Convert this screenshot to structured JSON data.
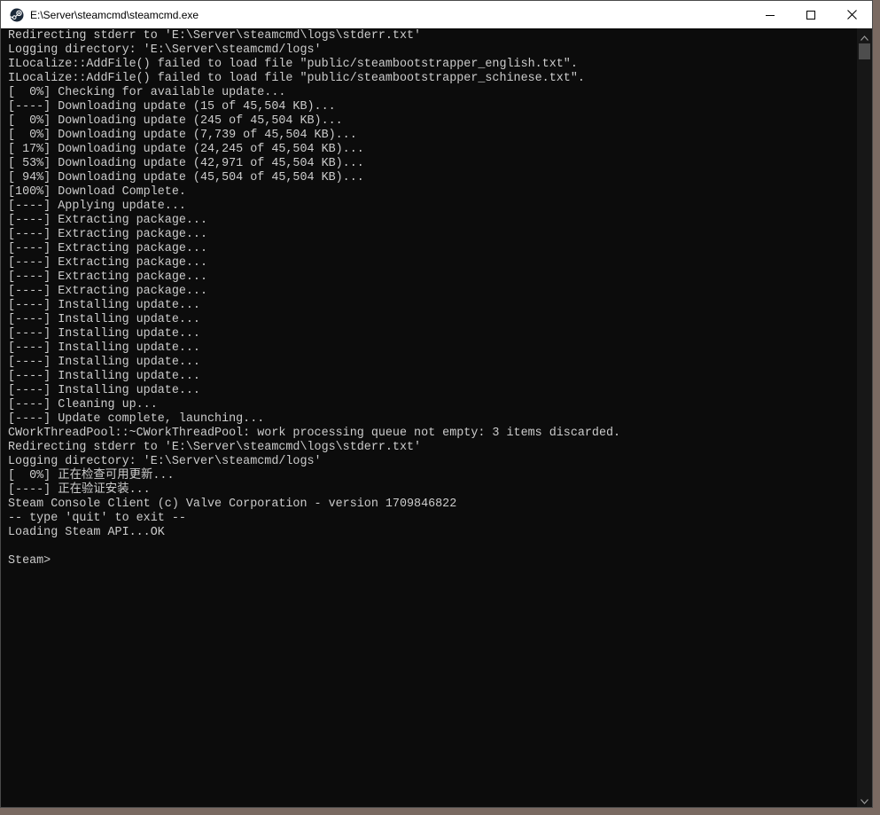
{
  "window": {
    "title": "E:\\Server\\steamcmd\\steamcmd.exe",
    "icon": "steam-icon",
    "caption_buttons": [
      "minimize-icon",
      "maximize-icon",
      "close-icon"
    ]
  },
  "console": {
    "lines": [
      "Redirecting stderr to 'E:\\Server\\steamcmd\\logs\\stderr.txt'",
      "Logging directory: 'E:\\Server\\steamcmd/logs'",
      "ILocalize::AddFile() failed to load file \"public/steambootstrapper_english.txt\".",
      "ILocalize::AddFile() failed to load file \"public/steambootstrapper_schinese.txt\".",
      "[  0%] Checking for available update...",
      "[----] Downloading update (15 of 45,504 KB)...",
      "[  0%] Downloading update (245 of 45,504 KB)...",
      "[  0%] Downloading update (7,739 of 45,504 KB)...",
      "[ 17%] Downloading update (24,245 of 45,504 KB)...",
      "[ 53%] Downloading update (42,971 of 45,504 KB)...",
      "[ 94%] Downloading update (45,504 of 45,504 KB)...",
      "[100%] Download Complete.",
      "[----] Applying update...",
      "[----] Extracting package...",
      "[----] Extracting package...",
      "[----] Extracting package...",
      "[----] Extracting package...",
      "[----] Extracting package...",
      "[----] Extracting package...",
      "[----] Installing update...",
      "[----] Installing update...",
      "[----] Installing update...",
      "[----] Installing update...",
      "[----] Installing update...",
      "[----] Installing update...",
      "[----] Installing update...",
      "[----] Cleaning up...",
      "[----] Update complete, launching...",
      "CWorkThreadPool::~CWorkThreadPool: work processing queue not empty: 3 items discarded.",
      "Redirecting stderr to 'E:\\Server\\steamcmd\\logs\\stderr.txt'",
      "Logging directory: 'E:\\Server\\steamcmd/logs'",
      "[  0%] 正在检查可用更新...",
      "[----] 正在验证安装...",
      "Steam Console Client (c) Valve Corporation - version 1709846822",
      "-- type 'quit' to exit --",
      "Loading Steam API...OK",
      "",
      "Steam>"
    ]
  },
  "colors": {
    "console_bg": "#0c0c0c",
    "console_text": "#cccccc",
    "titlebar_bg": "#ffffff",
    "scroll_thumb": "#4d4d4d"
  }
}
